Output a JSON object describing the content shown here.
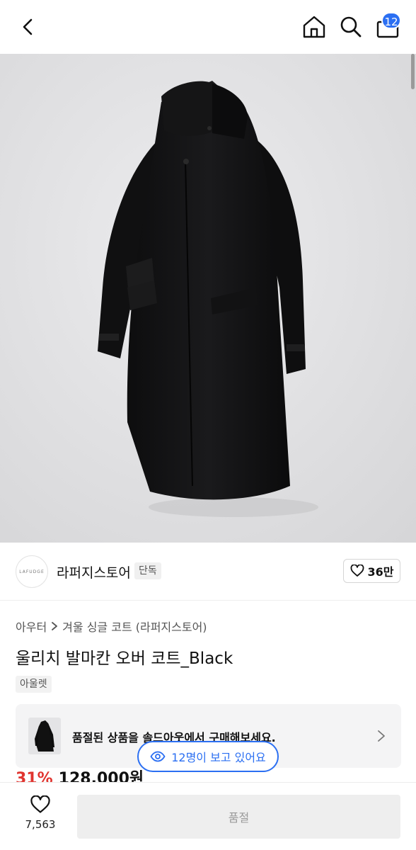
{
  "header": {
    "cart_count": "12",
    "icons": [
      "chevron-left-icon",
      "home-icon",
      "search-icon",
      "shopping-bag-icon"
    ],
    "accent_color": "#2b6ff2"
  },
  "store": {
    "logo_text": "LAFUDGE",
    "name": "라퍼지스토어",
    "tag": "단독",
    "likes": "36만"
  },
  "product": {
    "breadcrumb": [
      "아우터",
      "겨울 싱글 코트 (라퍼지스토어)"
    ],
    "title": "울리치 발마칸 오버 코트_Black",
    "chip": "아울렛",
    "discount": "31%",
    "price": "128,000원",
    "discount_color": "#e0342f"
  },
  "soldout_banner": {
    "message": "품절된 상품을 솔드아웃에서 구매해보세요."
  },
  "viewers": {
    "text": "12명이 보고 있어요"
  },
  "bottom_bar": {
    "wish_count": "7,563",
    "buy_label": "품절"
  }
}
